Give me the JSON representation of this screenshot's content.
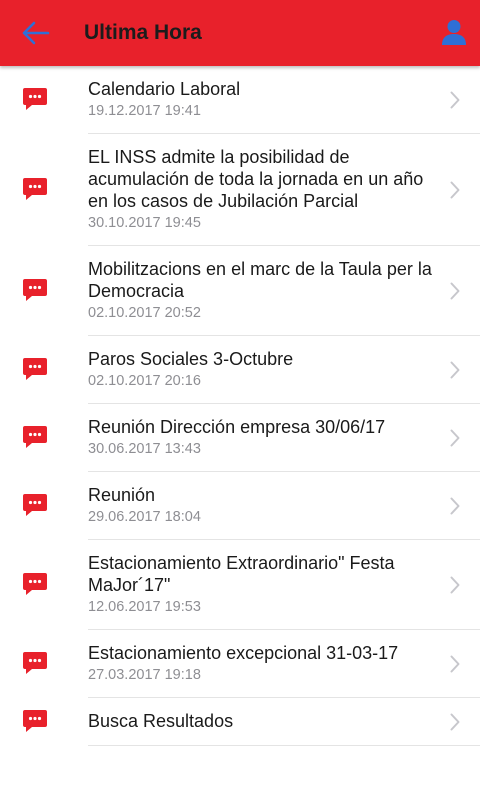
{
  "header": {
    "title": "Ultima Hora",
    "bg_color": "#e8212b",
    "icon_color": "#2f6fd6",
    "back_icon": "arrow-left-icon",
    "user_icon": "user-icon"
  },
  "list": {
    "item_icon": "chat-bubble-icon",
    "item_icon_color": "#e8212b",
    "chevron_icon": "chevron-right-icon",
    "items": [
      {
        "title": "Calendario Laboral",
        "date": "19.12.2017 19:41"
      },
      {
        "title": "EL INSS admite la posibilidad de acumulación de toda la jornada en un año en los casos de Jubilación Parcial",
        "date": "30.10.2017 19:45"
      },
      {
        "title": "Mobilitzacions en el marc de la Taula per la Democracia",
        "date": "02.10.2017 20:52"
      },
      {
        "title": "Paros Sociales 3-Octubre",
        "date": "02.10.2017 20:16"
      },
      {
        "title": "Reunión Dirección empresa 30/06/17",
        "date": "30.06.2017 13:43"
      },
      {
        "title": "Reunión",
        "date": "29.06.2017 18:04"
      },
      {
        "title": "Estacionamiento Extraordinario\" Festa MaJor´17\"",
        "date": "12.06.2017 19:53"
      },
      {
        "title": "Estacionamiento excepcional 31-03-17",
        "date": "27.03.2017 19:18"
      },
      {
        "title": "Busca Resultados",
        "date": ""
      }
    ]
  }
}
